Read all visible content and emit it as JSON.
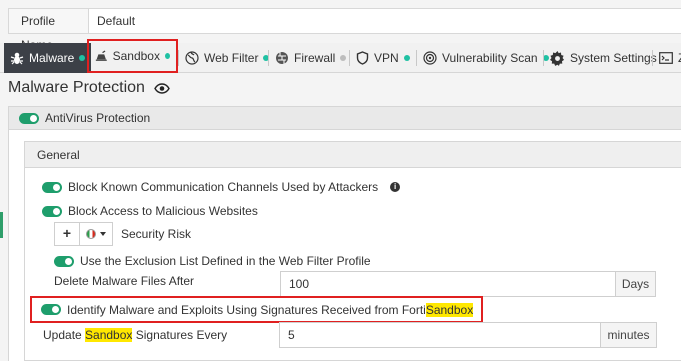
{
  "profile": {
    "label": "Profile Name",
    "value": "Default"
  },
  "tabs": [
    {
      "label": "Malware",
      "icon": "bug-icon",
      "dot": "green"
    },
    {
      "label": "Sandbox",
      "icon": "sandbox-icon",
      "dot": "green"
    },
    {
      "label": "Web Filter",
      "icon": "globe-icon",
      "dot": "green"
    },
    {
      "label": "Firewall",
      "icon": "firewall-icon",
      "dot": "grey"
    },
    {
      "label": "VPN",
      "icon": "shield-icon",
      "dot": "green"
    },
    {
      "label": "Vulnerability Scan",
      "icon": "target-icon",
      "dot": "green"
    },
    {
      "label": "System Settings",
      "icon": "gear-icon",
      "dot": ""
    },
    {
      "label": "Z",
      "icon": "terminal-icon",
      "dot": ""
    }
  ],
  "page_title": "Malware Protection",
  "antivirus": {
    "label": "AntiVirus Protection"
  },
  "general": {
    "title": "General",
    "block_comm": "Block Known Communication Channels Used by Attackers",
    "block_sites": "Block Access to Malicious Websites",
    "plus": "+",
    "security_risk": "Security Risk",
    "exclusion": "Use the Exclusion List Defined in the Web Filter Profile",
    "delete_label": "Delete Malware Files After",
    "delete_value": "100",
    "delete_unit": "Days",
    "identify_prefix": "Identify Malware and Exploits Using Signatures Received from Forti",
    "identify_highlight": "Sandbox",
    "update_prefix": "Update ",
    "update_highlight": "Sandbox",
    "update_suffix": " Signatures Every",
    "update_value": "5",
    "update_unit": "minutes"
  },
  "colors": {
    "accent": "#1e9e6c",
    "dot": "#1fc1a3",
    "highlight": "#ffe800",
    "annotation": "#e02020"
  }
}
